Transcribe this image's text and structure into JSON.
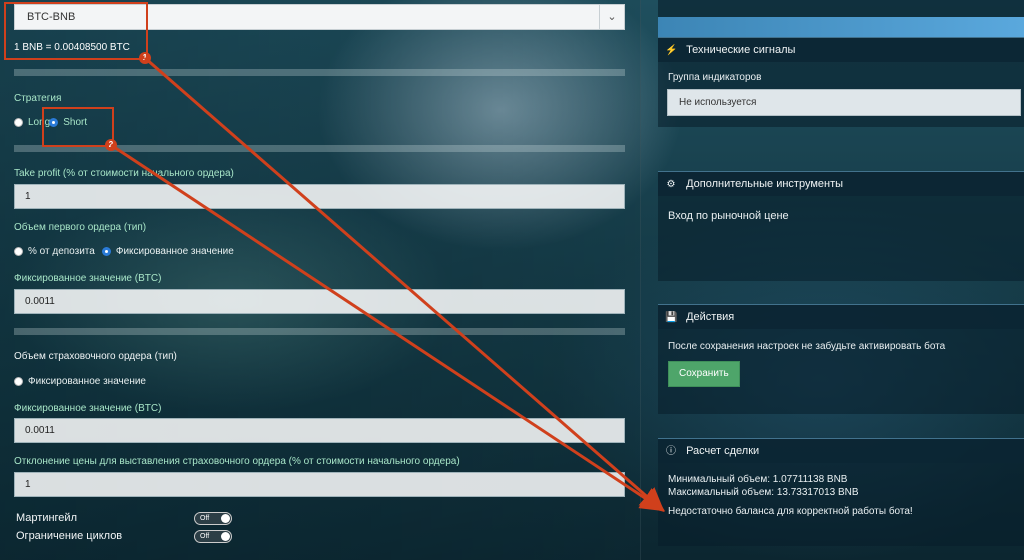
{
  "pair_select": {
    "value": "BTC-BNB"
  },
  "rate_text": "1 BNB = 0.00408500 BTC",
  "strategy": {
    "label": "Стратегия",
    "options": [
      "Long",
      "Short"
    ]
  },
  "take_profit": {
    "label": "Take profit (% от стоимости начального ордера)",
    "value": "1"
  },
  "first_order": {
    "label": "Объем первого ордера (тип)",
    "options": [
      "% от депозита",
      "Фиксированное значение"
    ]
  },
  "fixed_value_1": {
    "label": "Фиксированное значение (BTC)",
    "value": "0.0011"
  },
  "insurance_order": {
    "label": "Объем страховочного ордера (тип)",
    "option": "Фиксированное значение"
  },
  "fixed_value_2": {
    "label": "Фиксированное значение (BTC)",
    "value": "0.0011"
  },
  "deviation": {
    "label": "Отклонение цены для выставления страховочного ордера (% от стоимости начального ордера)",
    "value": "1"
  },
  "toggles": [
    {
      "label": "Мартингейл",
      "state": "Off"
    },
    {
      "label": "Ограничение циклов",
      "state": "Off"
    }
  ],
  "signals_panel": {
    "title": "Технические сигналы",
    "group_label": "Группа индикаторов",
    "group_value": "Не используется"
  },
  "tools_panel": {
    "title": "Дополнительные инструменты",
    "text": "Вход по рыночной цене"
  },
  "actions_panel": {
    "title": "Действия",
    "hint": "После сохранения настроек не забудьте активировать бота",
    "save_label": "Сохранить"
  },
  "calc_panel": {
    "title": "Расчет сделки",
    "min": "Минимальный объем: 1.07711138 BNB",
    "max": "Максимальный объем: 13.73317013 BNB",
    "warning": "Недостаточно баланса для корректной работы бота!"
  },
  "annotations": [
    "1",
    "2"
  ],
  "colors": {
    "accent_green": "#a8e6c8",
    "save_button": "#4ea56a",
    "annotation": "#d0401c"
  }
}
